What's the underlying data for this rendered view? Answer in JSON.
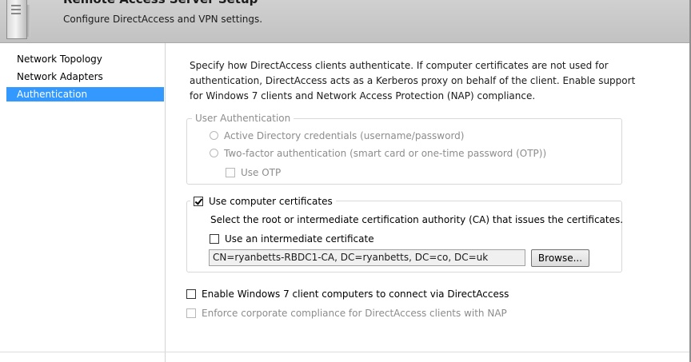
{
  "header": {
    "title": "Remote Access Server Setup",
    "subtitle": "Configure DirectAccess and VPN settings."
  },
  "sidebar": {
    "items": [
      {
        "label": "Network Topology",
        "active": false
      },
      {
        "label": "Network Adapters",
        "active": false
      },
      {
        "label": "Authentication",
        "active": true
      }
    ]
  },
  "main": {
    "description": "Specify how DirectAccess clients authenticate. If computer certificates are not used for authentication, DirectAccess acts as a Kerberos proxy on behalf of the client. Enable support for Windows 7 clients and Network Access Protection (NAP) compliance.",
    "user_auth": {
      "legend": "User Authentication",
      "option_ad": "Active Directory credentials (username/password)",
      "option_2fa": "Two-factor authentication (smart card or one-time password (OTP))",
      "use_otp": "Use OTP"
    },
    "certs": {
      "label": "Use computer certificates",
      "checked": true,
      "instruction": "Select the root or intermediate certification authority (CA) that issues the certificates.",
      "intermediate_label": "Use an intermediate certificate",
      "ca_value": "CN=ryanbetts-RBDC1-CA, DC=ryanbetts, DC=co, DC=uk",
      "browse_label": "Browse..."
    },
    "win7_label": "Enable Windows 7 client computers to connect via DirectAccess",
    "nap_label": "Enforce corporate compliance for DirectAccess clients with NAP"
  }
}
